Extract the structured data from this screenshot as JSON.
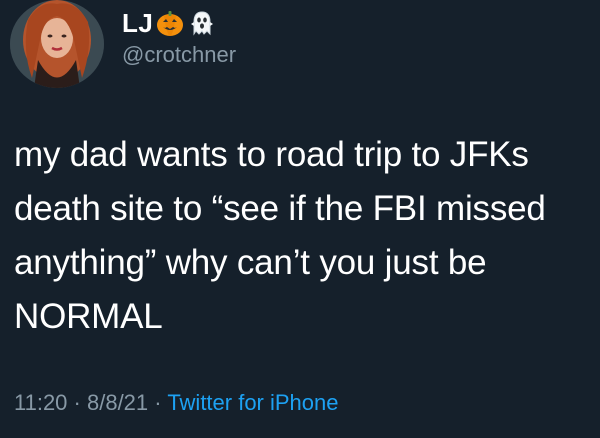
{
  "user": {
    "display_name": "LJ",
    "handle": "@crotchner",
    "name_emojis": [
      "jack-o-lantern-icon",
      "ghost-icon"
    ]
  },
  "tweet": {
    "lines": [
      "my dad wants to road trip to JFKs",
      "death site to “see if the FBI missed",
      "anything” why can’t you just be",
      "NORMAL"
    ]
  },
  "meta": {
    "time": "11:20",
    "separator": " · ",
    "date": "8/8/21",
    "source": "Twitter for iPhone"
  },
  "colors": {
    "background": "#15202b",
    "secondary_text": "#8899a6",
    "link": "#1da1f2"
  }
}
